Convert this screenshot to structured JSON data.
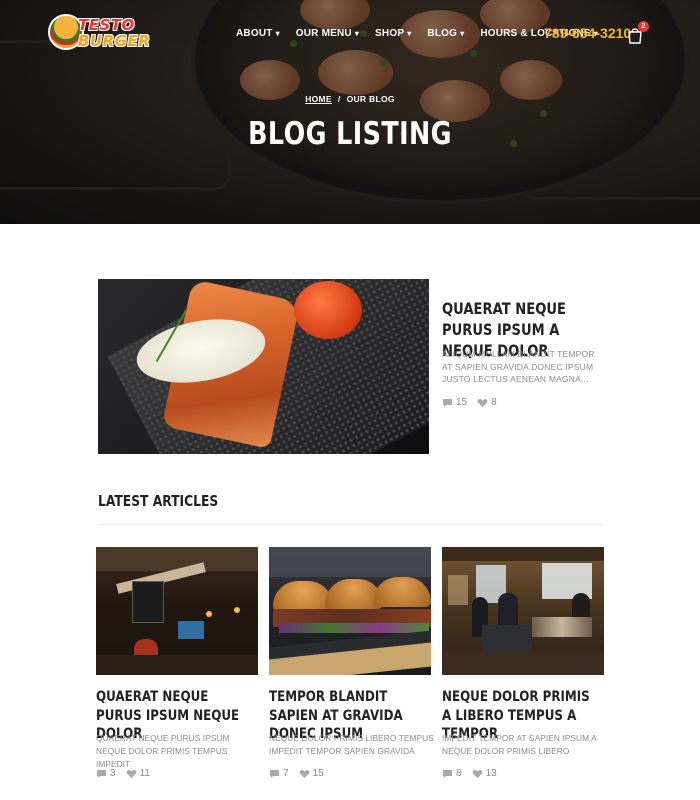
{
  "header": {
    "logo_text_top": "TESTO",
    "logo_text_bottom": "BURGER",
    "nav": [
      {
        "label": "ABOUT"
      },
      {
        "label": "OUR MENU"
      },
      {
        "label": "SHOP"
      },
      {
        "label": "BLOG"
      },
      {
        "label": "HOURS & LOCATIONS"
      }
    ],
    "phone": "789-654-3210",
    "cart_count": "2",
    "accent_color": "#f5b32d",
    "badge_color": "#e53935"
  },
  "hero": {
    "breadcrumb": {
      "home": "HOME",
      "separator": "/",
      "current": "OUR BLOG"
    },
    "title": "BLOG LISTING"
  },
  "featured": {
    "title": "QUAERAT NEQUE PURUS IPSUM A NEQUE DOLOR",
    "excerpt": "ALIQUM MULLAM BLANDIT TEMPOR AT SAPIEN GRAVIDA DONEC IPSUM JUSTO LECTUS AENEAN MAGNA...",
    "comments": "15",
    "likes": "8"
  },
  "latest": {
    "heading": "LATEST ARTICLES",
    "articles": [
      {
        "title": "QUAERAT NEQUE PURUS IPSUM NEQUE DOLOR",
        "excerpt": "QUAERAT NEQUE PURUS IPSUM NEQUE DOLOR PRIMIS TEMPUS IMPEDIT",
        "comments": "3",
        "likes": "11"
      },
      {
        "title": "TEMPOR BLANDIT SAPIEN AT GRAVIDA DONEC IPSUM",
        "excerpt": "NEQUE DOLOR PRIMIS LIBERO TEMPUS IMPEDIT TEMPOR SAPIEN GRAVIDA",
        "comments": "7",
        "likes": "15"
      },
      {
        "title": "NEQUE DOLOR PRIMIS A LIBERO TEMPUS A TEMPOR",
        "excerpt": "IMPEDIT TEMPOR AT SAPIEN IPSUM A NEQUE DOLOR PRIMIS LIBERO",
        "comments": "8",
        "likes": "13"
      }
    ]
  }
}
